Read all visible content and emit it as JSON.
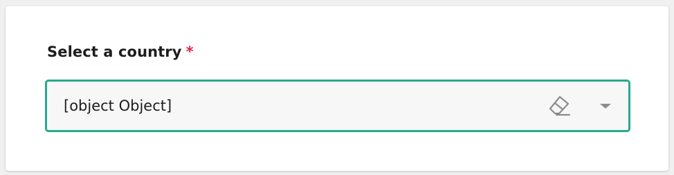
{
  "field": {
    "label": "Select a country",
    "required_marker": "*",
    "selected_value": "[object Object]"
  },
  "icons": {
    "clear": "eraser-icon",
    "dropdown": "chevron-down-icon"
  },
  "colors": {
    "accent_border": "#26a98c",
    "required": "#e0244a",
    "icon": "#8c8c8c"
  }
}
